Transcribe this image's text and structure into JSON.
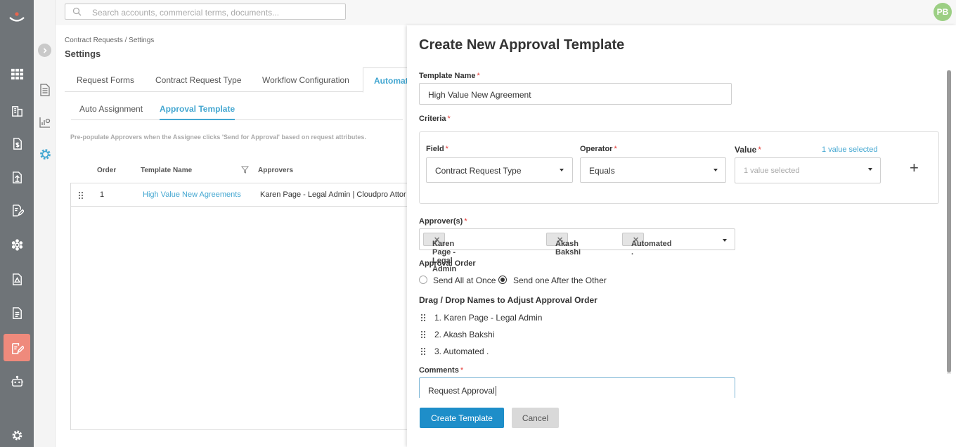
{
  "search": {
    "placeholder": "Search accounts, commercial terms, documents..."
  },
  "user": {
    "initials": "PB"
  },
  "rail": {
    "icons": [
      "logo-icon",
      "apps-grid-icon",
      "building-icon",
      "dollar-doc-icon",
      "upload-doc-icon",
      "edit-doc-icon",
      "settings-flower-icon",
      "alert-doc-icon",
      "list-doc-icon",
      "contract-edit-icon",
      "bot-icon",
      "gear-icon"
    ],
    "active_color": "#ef8a7c"
  },
  "page": {
    "breadcrumb": "Contract Requests / Settings",
    "title": "Settings",
    "tabs": [
      "Request Forms",
      "Contract Request Type",
      "Workflow Configuration",
      "Automat"
    ],
    "subtabs": [
      "Auto Assignment",
      "Approval Template"
    ],
    "hint": "Pre-populate Approvers when the Assignee clicks 'Send for Approval' based on request attributes.",
    "table": {
      "headers": [
        "Order",
        "Template Name",
        "Approvers"
      ],
      "rows": [
        {
          "order": "1",
          "name": "High Value New Agreements",
          "approvers": "Karen Page - Legal Admin | Cloudpro Attor"
        }
      ]
    }
  },
  "panel": {
    "title": "Create New Approval Template",
    "template_name_label": "Template Name",
    "template_name_value": "High Value New Agreement",
    "criteria_label": "Criteria",
    "field_label": "Field",
    "field_value": "Contract Request Type",
    "operator_label": "Operator",
    "operator_value": "Equals",
    "value_label": "Value",
    "value_selected_link": "1 value selected",
    "value_placeholder": "1 value selected",
    "add_symbol": "+",
    "approvers_label": "Approver(s)",
    "approver_chips": [
      "Karen Page - Legal Admin",
      "Akash Bakshi",
      "Automated ."
    ],
    "approval_order_label": "Approval Order",
    "radio_options": [
      "Send All at Once",
      "Send one After the Other"
    ],
    "radio_selected": "Send one After the Other",
    "drag_label": "Drag / Drop Names to Adjust Approval Order",
    "ordered_approvers": [
      "1. Karen Page - Legal Admin",
      "2. Akash Bakshi",
      "3. Automated ."
    ],
    "comments_label": "Comments",
    "comments_value": "Request Approval",
    "create_button": "Create Template",
    "cancel_button": "Cancel",
    "required_mark": "*"
  },
  "colors": {
    "accent": "#44a7d1",
    "primary_button": "#1e8ec9",
    "required": "#e53935"
  }
}
